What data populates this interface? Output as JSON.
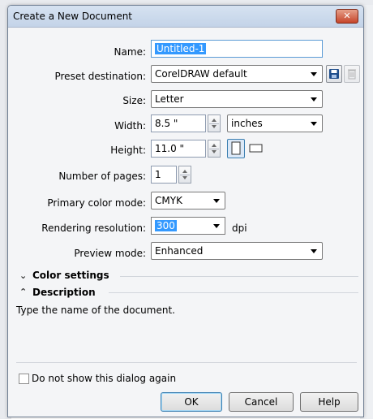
{
  "window": {
    "title": "Create a New Document"
  },
  "form": {
    "name_label": "Name:",
    "name_value": "Untitled-1",
    "preset_label": "Preset destination:",
    "preset_value": "CorelDRAW default",
    "size_label": "Size:",
    "size_value": "Letter",
    "width_label": "Width:",
    "width_value": "8.5 \"",
    "units_value": "inches",
    "height_label": "Height:",
    "height_value": "11.0 \"",
    "pages_label": "Number of pages:",
    "pages_value": "1",
    "color_mode_label": "Primary color mode:",
    "color_mode_value": "CMYK",
    "resolution_label": "Rendering resolution:",
    "resolution_value": "300",
    "resolution_unit": "dpi",
    "preview_label": "Preview mode:",
    "preview_value": "Enhanced"
  },
  "sections": {
    "color_settings": "Color settings",
    "description": "Description",
    "description_text": "Type the name of the document."
  },
  "footer": {
    "dont_show": "Do not show this dialog again",
    "ok": "OK",
    "cancel": "Cancel",
    "help": "Help"
  },
  "icons": {
    "save": "save-icon",
    "delete": "trash-icon",
    "portrait": "portrait-icon",
    "landscape": "landscape-icon",
    "close": "close-icon"
  }
}
